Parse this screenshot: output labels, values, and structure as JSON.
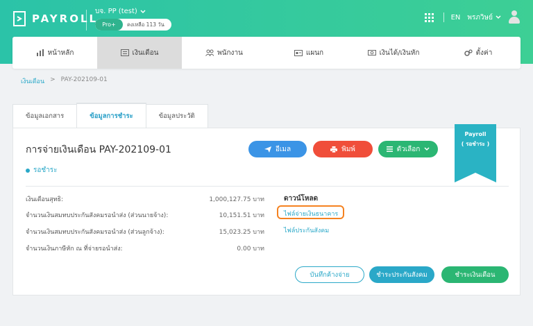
{
  "header": {
    "logo_text": "PAYROLL",
    "company": "บจ. PP (test)",
    "plan_badge": "Pro+",
    "plan_remaining": "คงเหลือ 113 วัน",
    "language": "EN",
    "username": "พรภวิษย์"
  },
  "nav": {
    "items": [
      {
        "label": "หน้าหลัก",
        "icon": "chart-icon"
      },
      {
        "label": "เงินเดือน",
        "icon": "payslip-icon"
      },
      {
        "label": "พนักงาน",
        "icon": "people-icon"
      },
      {
        "label": "แผนก",
        "icon": "department-icon"
      },
      {
        "label": "เงินได้/เงินหัก",
        "icon": "money-icon"
      },
      {
        "label": "ตั้งค่า",
        "icon": "gear-icon"
      }
    ],
    "active_index": 1
  },
  "breadcrumb": {
    "parent": "เงินเดือน",
    "sep": ">",
    "current": "PAY-202109-01"
  },
  "tabs": [
    "ข้อมูลเอกสาร",
    "ข้อมูลการชำระ",
    "ข้อมูลประวัติ"
  ],
  "card": {
    "title": "การจ่ายเงินเดือน PAY-202109-01",
    "status": "รอชำระ",
    "buttons": {
      "email": "อีเมล",
      "print": "พิมพ์",
      "options": "ตัวเลือก"
    },
    "ribbon": {
      "line1": "Payroll",
      "line2": "( รอชำระ )"
    },
    "rows": [
      {
        "label": "เงินเดือนสุทธิ:",
        "value": "1,000,127.75 บาท"
      },
      {
        "label": "จำนวนเงินสมทบประกันสังคมรอนำส่ง (ส่วนนายจ้าง):",
        "value": "10,151.51 บาท"
      },
      {
        "label": "จำนวนเงินสมทบประกันสังคมรอนำส่ง (ส่วนลูกจ้าง):",
        "value": "15,023.25 บาท"
      },
      {
        "label": "จำนวนเงินภาษีหัก ณ ที่จ่ายรอนำส่ง:",
        "value": "0.00 บาท"
      }
    ],
    "download": {
      "title": "ดาวน์โหลด",
      "bank_file": "ไฟล์จ่ายเงินธนาคาร",
      "social_file": "ไฟล์ประกันสังคม"
    },
    "actions": {
      "save": "บันทึกค้างจ่าย",
      "pay_social": "ชำระประกันสังคม",
      "pay_salary": "ชำระเงินเดือน"
    }
  },
  "colors": {
    "header_from": "#2bc3a8",
    "header_to": "#3dcf95",
    "accent": "#2aa8c8",
    "email": "#3b94e6",
    "print": "#f04e3a",
    "green": "#2bb673",
    "highlight": "#f58220"
  }
}
